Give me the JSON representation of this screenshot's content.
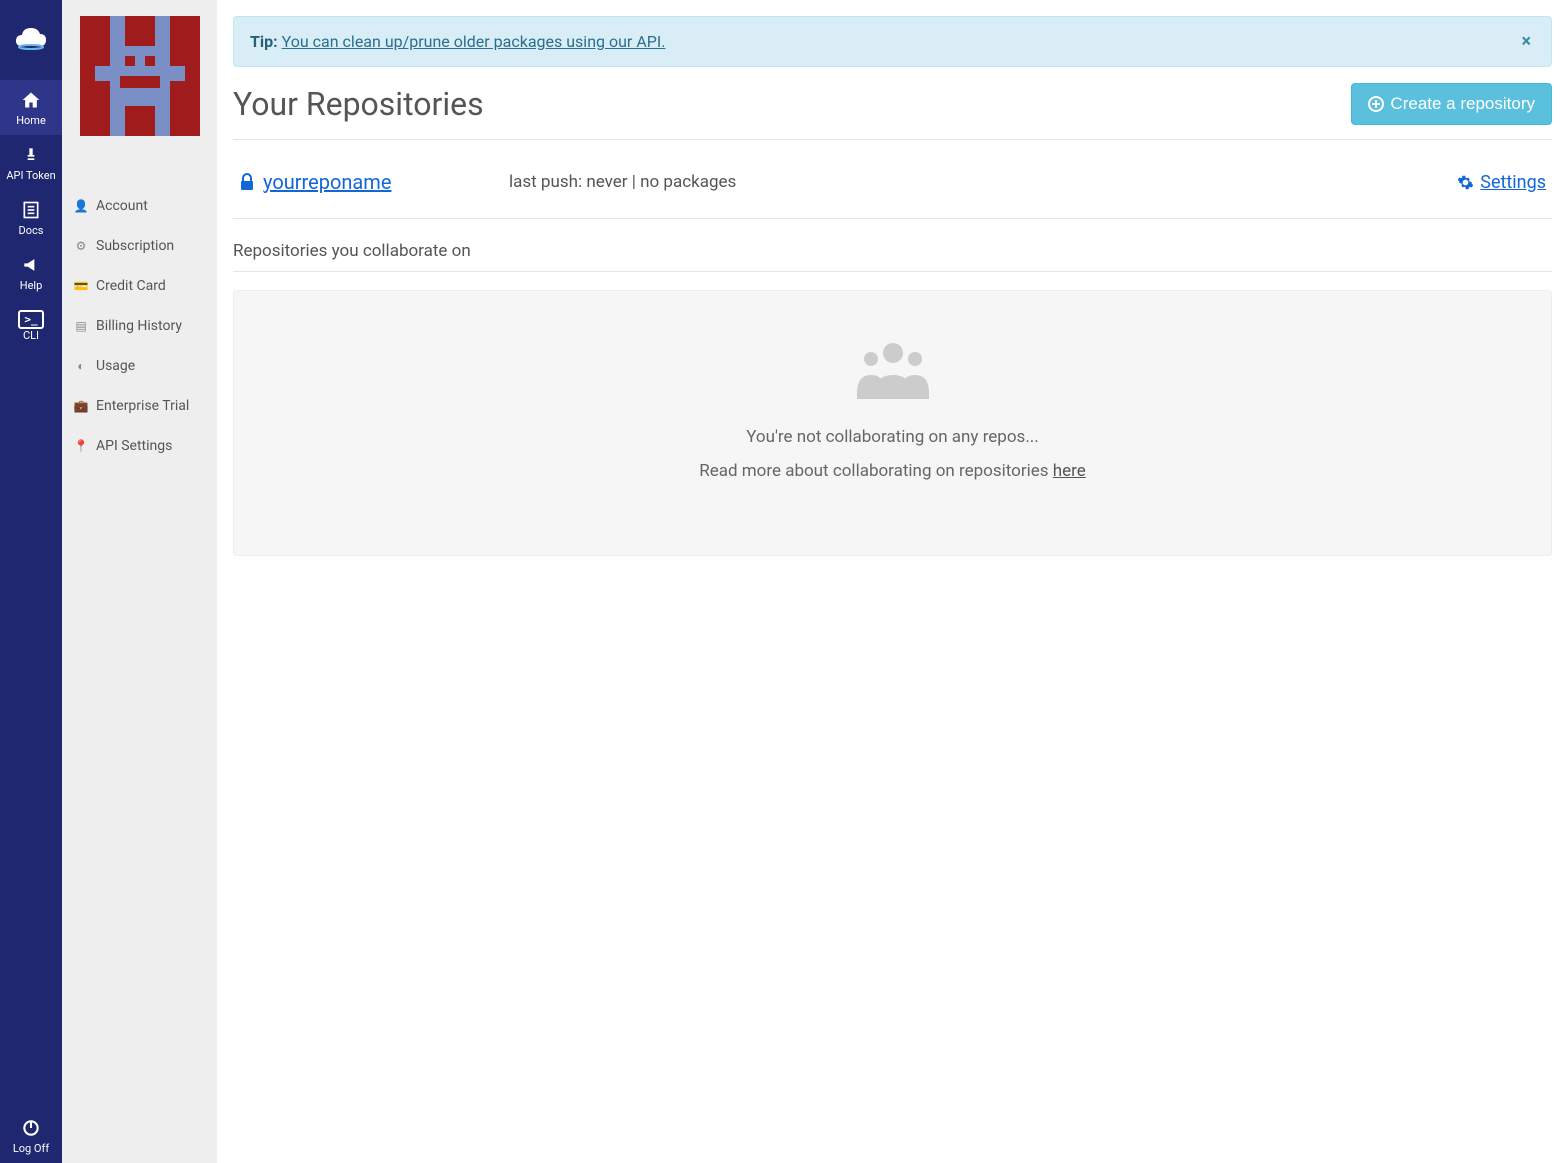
{
  "nav": {
    "logo": "cloud",
    "items": [
      {
        "label": "Home",
        "icon": "home",
        "active": true
      },
      {
        "label": "API Token",
        "icon": "key"
      },
      {
        "label": "Docs",
        "icon": "doc"
      },
      {
        "label": "Help",
        "icon": "bullhorn"
      },
      {
        "label": "CLI",
        "icon": "cli"
      }
    ],
    "logoff": "Log Off"
  },
  "sidebar": {
    "items": [
      {
        "label": "Account",
        "icon": "user"
      },
      {
        "label": "Subscription",
        "icon": "gear"
      },
      {
        "label": "Credit Card",
        "icon": "card"
      },
      {
        "label": "Billing History",
        "icon": "list"
      },
      {
        "label": "Usage",
        "icon": "dash"
      },
      {
        "label": "Enterprise Trial",
        "icon": "briefcase"
      },
      {
        "label": "API Settings",
        "icon": "pin"
      }
    ]
  },
  "alert": {
    "tip_label": "Tip:",
    "text": "You can clean up/prune older packages using our API.",
    "close": "×"
  },
  "page": {
    "title": "Your Repositories",
    "create_button": "Create a repository"
  },
  "repo": {
    "name": "yourreponame",
    "status": "last push: never | no packages",
    "settings": "Settings"
  },
  "collab": {
    "heading": "Repositories you collaborate on",
    "empty_line1": "You're not collaborating on any repos...",
    "empty_line2_prefix": "Read more about collaborating on repositories ",
    "empty_line2_link": "here"
  }
}
